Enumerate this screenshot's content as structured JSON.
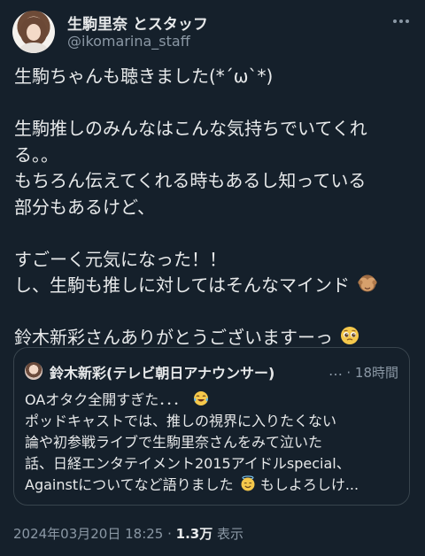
{
  "header": {
    "display_name": "生駒里奈 とスタッフ",
    "handle": "@ikomarina_staff",
    "more_icon": "more-icon"
  },
  "tweet": {
    "lines": [
      "生駒ちゃんも聴きました(*´ω`*)",
      "",
      "生駒推しのみんなはこんな気持ちでいてくれ",
      "る。。",
      "もちろん伝えてくれる時もあるし知っている",
      "部分もあるけど、",
      "",
      "すごーく元気になった！！",
      "し、生駒も推しに対してはそんなマインド",
      "",
      "鈴木新彩さんありがとうございますーっ"
    ],
    "emoji_monkey": "see-no-evil-monkey-icon",
    "emoji_pleading": "pleading-face-icon"
  },
  "quote": {
    "name": "鈴木新彩(テレビ朝日アナウンサー)",
    "ellipsis": "…",
    "time": "· 18時間",
    "lines": [
      "OAオタク全開すぎた．．．",
      "ポッドキャストでは、推しの視界に入りたくない",
      "論や初参戦ライブで生駒里奈さんをみて泣いた",
      "話、日経エンタテイメント2015アイドルspecial、",
      "Againstについてなど語りました",
      "もしよろしけ..."
    ],
    "emoji_laugh": "face-with-tears-of-joy-icon",
    "emoji_halo": "smiling-face-with-halo-icon"
  },
  "meta": {
    "datetime": "2024年03月20日 18:25 · ",
    "views": "1.3万",
    "views_label": " 表示"
  },
  "colors": {
    "background": "#15202b",
    "text": "#e7e9ea",
    "muted": "#8b98a5",
    "border": "#38444d"
  }
}
